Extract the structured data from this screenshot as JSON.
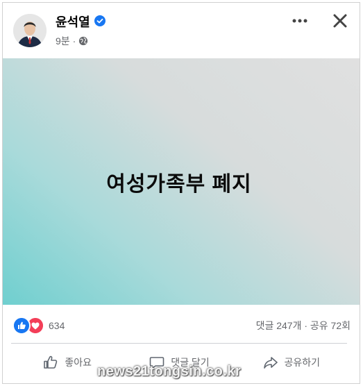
{
  "post": {
    "author": "윤석열",
    "time": "9분",
    "separator": "·",
    "text": "여성가족부 폐지"
  },
  "engagement": {
    "reaction_count": "634",
    "stats": "댓글 247개 · 공유 72회"
  },
  "actions": {
    "like": "좋아요",
    "comment": "댓글 달기",
    "share": "공유하기"
  },
  "watermark": "news21tongsin.co.kr",
  "colors": {
    "verified": "#1877f2",
    "like_reaction": "#1877f2",
    "love_reaction": "#f33e58",
    "gradient_start": "#6fcfcf",
    "gradient_end": "#e0e0e0"
  },
  "icons": [
    "verified-badge-icon",
    "globe-icon",
    "more-icon",
    "close-icon",
    "like-reaction-icon",
    "love-reaction-icon",
    "thumbs-up-icon",
    "comment-icon",
    "share-icon"
  ]
}
